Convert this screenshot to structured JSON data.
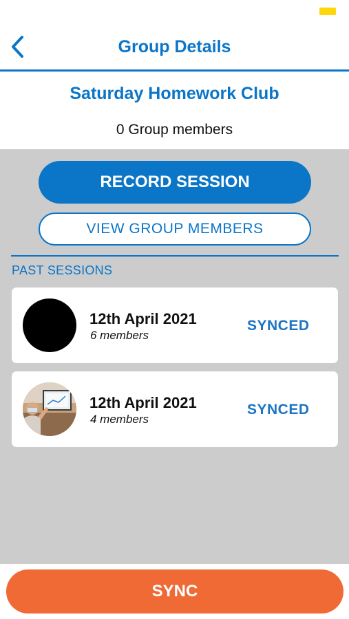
{
  "nav": {
    "title": "Group Details",
    "back_icon": "chevron-left-icon"
  },
  "group": {
    "name": "Saturday Homework Club",
    "member_count_label": "0 Group members"
  },
  "actions": {
    "record_session_label": "RECORD SESSION",
    "view_members_label": "VIEW GROUP MEMBERS"
  },
  "past_sessions": {
    "title": "PAST SESSIONS",
    "items": [
      {
        "date": "12th April 2021",
        "members": "6 members",
        "status": "SYNCED",
        "avatar": "black-avatar"
      },
      {
        "date": "12th April 2021",
        "members": "4 members",
        "status": "SYNCED",
        "avatar": "photo-avatar"
      }
    ]
  },
  "footer": {
    "sync_label": "SYNC"
  },
  "colors": {
    "primary": "#0b75c8",
    "accent": "#f06a36",
    "background": "#cccccc",
    "battery": "#ffd60a"
  }
}
